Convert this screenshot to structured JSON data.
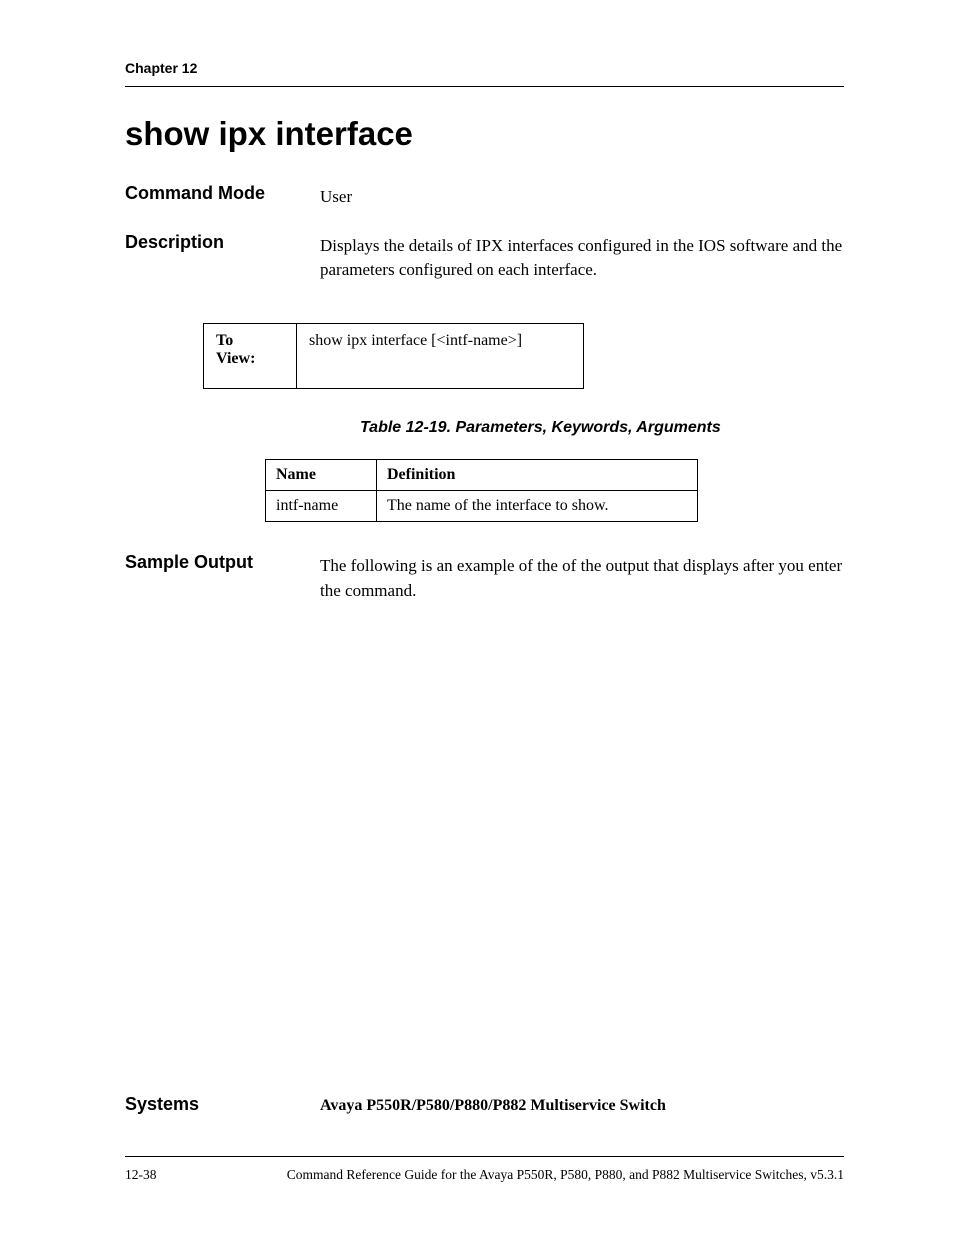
{
  "header": {
    "chapter": "Chapter 12"
  },
  "title": "show ipx interface",
  "command_mode": {
    "label": "Command Mode",
    "value": "User"
  },
  "description": {
    "label": "Description",
    "value": "Displays the details of IPX interfaces configured in the IOS software and the parameters configured on each interface."
  },
  "syntax": {
    "label": "To View:",
    "value": "show ipx interface [<intf-name>]"
  },
  "param_table": {
    "caption": "Table 12-19.  Parameters, Keywords, Arguments",
    "headers": {
      "name": "Name",
      "definition": "Definition"
    },
    "rows": [
      {
        "name": "intf-name",
        "definition": "The name of the interface to show."
      }
    ]
  },
  "sample_output": {
    "label": "Sample Output",
    "prefix": "The following is an example of the of the output that displays after you enter the ",
    "suffix": " command."
  },
  "systems": {
    "label": "Systems",
    "value": "Avaya P550R/P580/P880/P882 Multiservice Switch"
  },
  "footer": {
    "page": "12-38",
    "text": "Command Reference Guide for the Avaya P550R, P580, P880, and P882 Multiservice Switches, v5.3.1"
  }
}
